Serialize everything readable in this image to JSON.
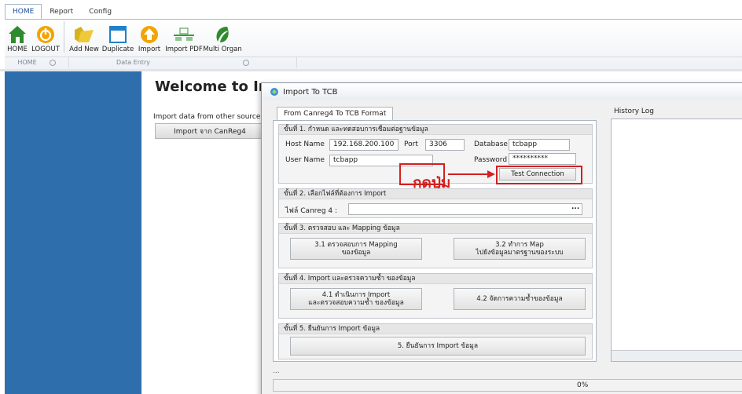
{
  "ribbon": {
    "tabs": [
      "HOME",
      "Report",
      "Config"
    ],
    "active_tab": "HOME",
    "buttons": {
      "home": "HOME",
      "logout": "LOGOUT",
      "add_new": "Add New",
      "duplicate": "Duplicate",
      "import": "Import",
      "import_pdf": "Import PDF",
      "multi_organ": "Multi Organ"
    },
    "groups": {
      "home": "HOME",
      "data_entry": "Data Entry"
    }
  },
  "main": {
    "welcome": "Welcome to Ir",
    "import_label": "Import data from other source",
    "import_button": "Import จาก CanReg4"
  },
  "dialog": {
    "title": "Import To TCB",
    "tab": "From Canreg4 To TCB Format",
    "step1": {
      "header": "ขั้นที่ 1. กำหนด และทดสอบการเชื่อมต่อฐานข้อมูล",
      "host_label": "Host Name",
      "host_value": "192.168.200.100",
      "port_label": "Port",
      "port_value": "3306",
      "database_label": "Database",
      "database_value": "tcbapp",
      "user_label": "User Name",
      "user_value": "tcbapp",
      "password_label": "Password",
      "password_value": "**********",
      "test_button": "Test Connection",
      "annotation": "กดปุ่ม"
    },
    "step2": {
      "header": "ขั้นที่ 2. เลือกไฟล์ที่ต้องการ Import",
      "file_label": "ไฟล์ Canreg 4 :",
      "file_value": "",
      "browse": "..."
    },
    "step3": {
      "header": "ขั้นที่ 3. ตรวจสอบ และ Mapping ข้อมูล",
      "btn1_line1": "3.1 ตรวจสอบการ Mapping",
      "btn1_line2": "ของข้อมูล",
      "btn2_line1": "3.2 ทำการ Map",
      "btn2_line2": "ไปยังข้อมูลมาตรฐานของระบบ"
    },
    "step4": {
      "header": "ขั้นที่ 4. Import และตรวจความซ้ำ ของข้อมูล",
      "btn1_line1": "4.1 ดำเนินการ Import",
      "btn1_line2": "และตรวจสอบความซ้ำ ของข้อมูล",
      "btn2": "4.2 จัดการความซ้ำของข้อมูล"
    },
    "step5": {
      "header": "ขั้นที่ 5. ยืนยันการ Import ข้อมูล",
      "btn": "5. ยืนยันการ Import ข้อมูล"
    },
    "history_label": "History Log",
    "status": "...",
    "progress": {
      "value": 0,
      "label": "0%"
    }
  },
  "colors": {
    "sidebar": "#2e6ead",
    "annotation": "#d32020",
    "home_icon": "#2e8b2e",
    "logout_icon": "#f2a400"
  }
}
